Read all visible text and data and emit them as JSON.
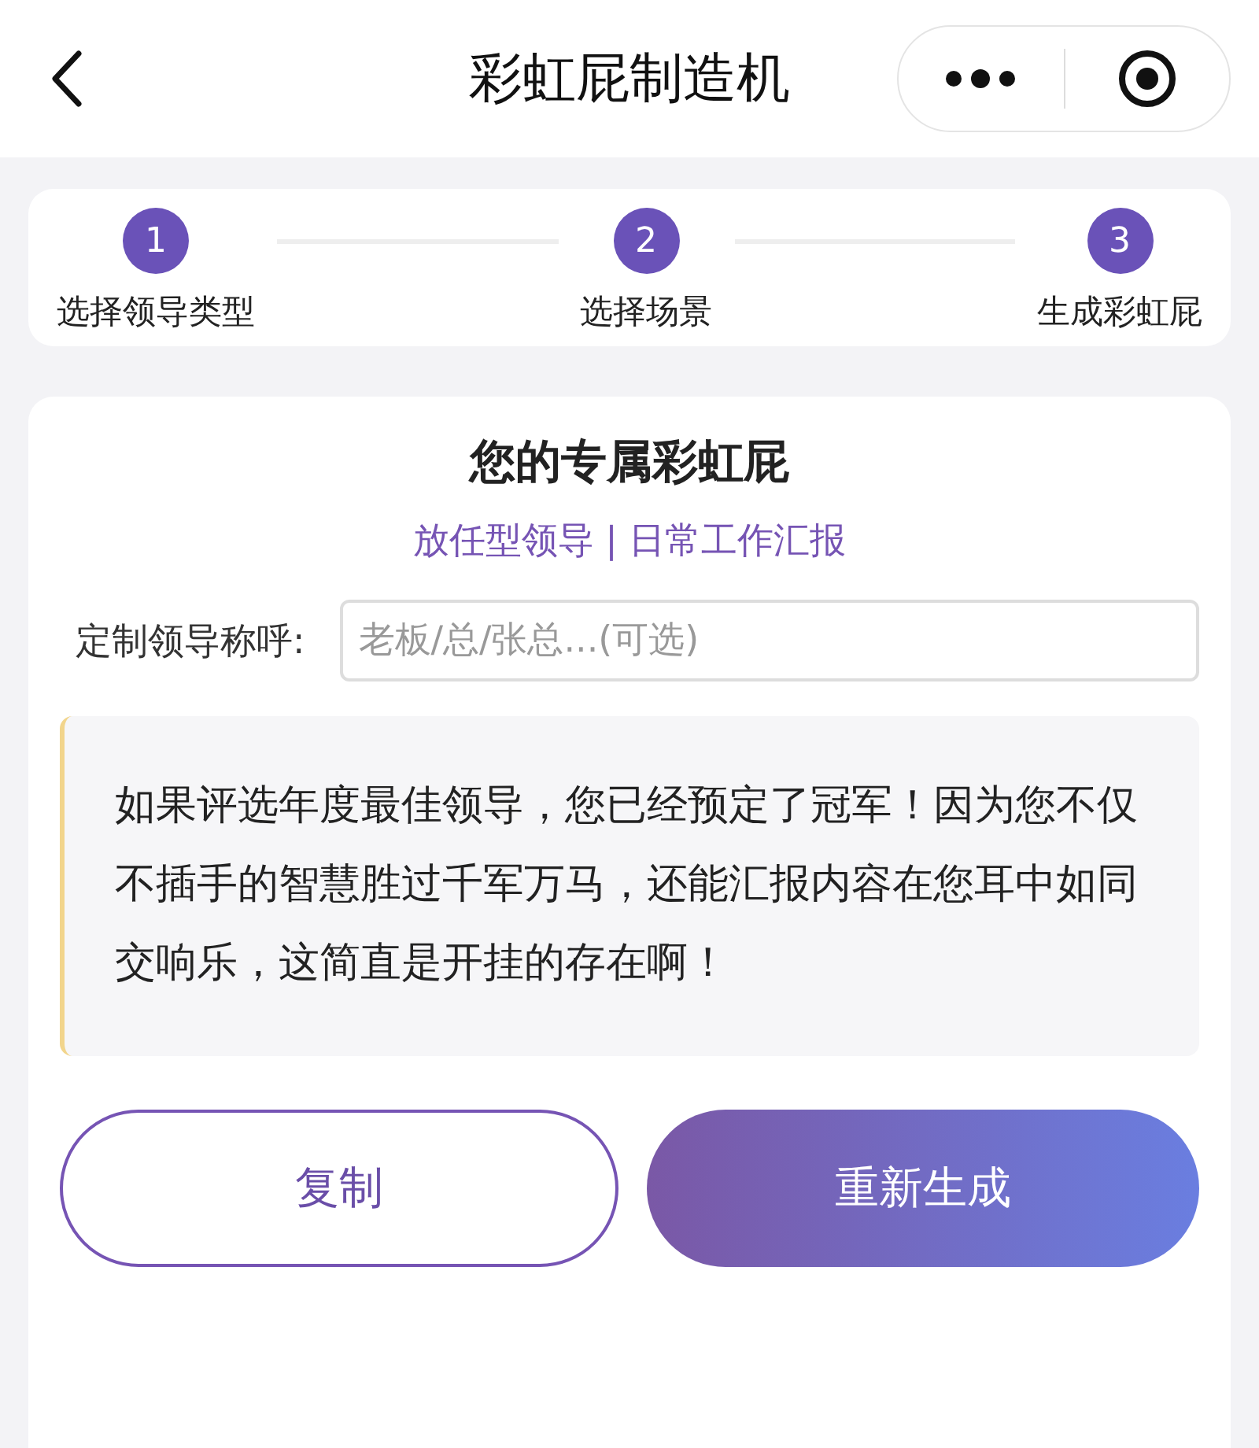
{
  "nav": {
    "title": "彩虹屁制造机"
  },
  "steps": [
    {
      "number": "1",
      "label": "选择领导类型",
      "done": true
    },
    {
      "number": "2",
      "label": "选择场景",
      "done": true
    },
    {
      "number": "3",
      "label": "生成彩虹屁",
      "done": true
    }
  ],
  "result": {
    "title": "您的专属彩虹屁",
    "subtitle": "放任型领导 | 日常工作汇报",
    "name_label": "定制领导称呼:",
    "name_field": {
      "placeholder": "老板/总/张总...(可选)"
    },
    "text": "如果评选年度最佳领导，您已经预定了冠军！因为您不仅不插手的智慧胜过千军万马，还能汇报内容在您耳中如同交响乐，这简直是开挂的存在啊！"
  },
  "buttons": [
    {
      "label": "复制",
      "kind": "outline"
    },
    {
      "label": "重新生成",
      "kind": "primary"
    }
  ]
}
